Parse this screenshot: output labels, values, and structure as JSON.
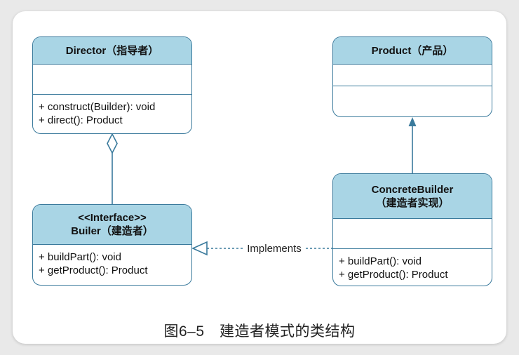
{
  "classes": {
    "director": {
      "header": "Director（指导者）",
      "methods": [
        "+ construct(Builder): void",
        "+ direct(): Product"
      ]
    },
    "product": {
      "header": "Product（产品）",
      "methods": []
    },
    "builder": {
      "stereotype": "<<Interface>>",
      "header": "Builer（建造者）",
      "methods": [
        "+ buildPart(): void",
        "+ getProduct(): Product"
      ]
    },
    "concrete_builder": {
      "header_line1": "ConcreteBuilder",
      "header_line2": "（建造者实现）",
      "methods": [
        "+ buildPart(): void",
        "+ getProduct(): Product"
      ]
    }
  },
  "relations": {
    "implements_label": "Implements"
  },
  "caption": "图6–5　建造者模式的类结构",
  "colors": {
    "header_fill": "#a9d5e5",
    "border": "#3a7a9c"
  }
}
